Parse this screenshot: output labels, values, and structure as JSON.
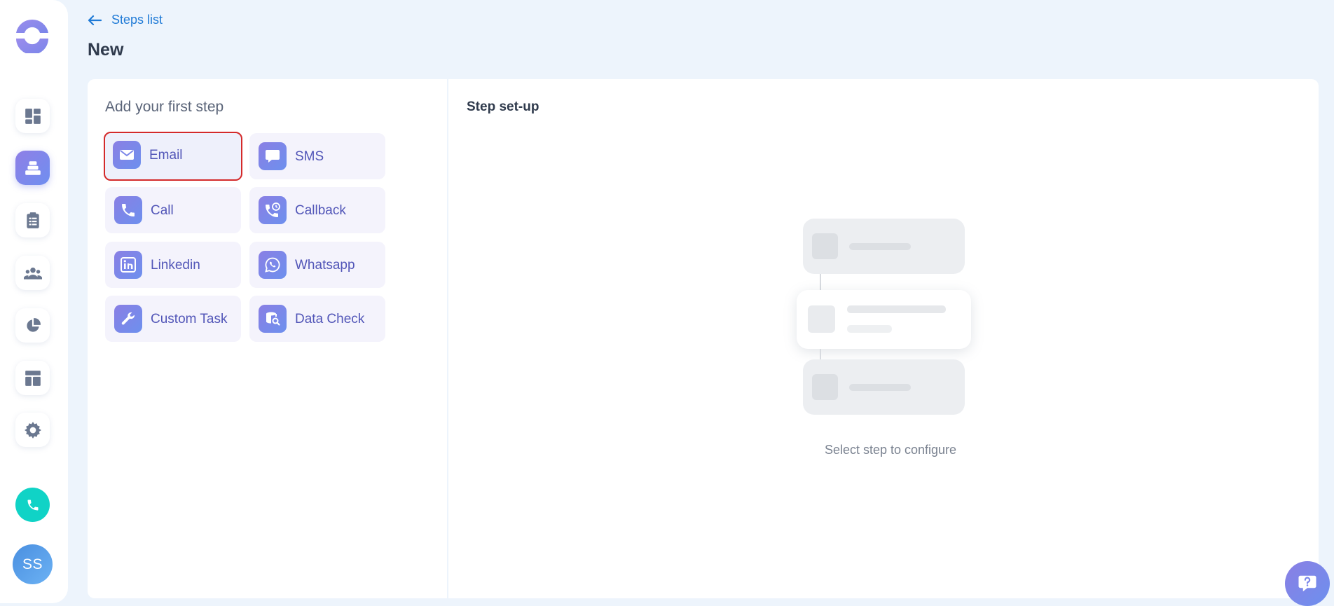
{
  "header": {
    "back_label": "Steps list",
    "title": "New"
  },
  "sidebar": {
    "items": [
      {
        "icon": "dashboard-icon",
        "active": false
      },
      {
        "icon": "sequences-icon",
        "active": true
      },
      {
        "icon": "tasks-icon",
        "active": false
      },
      {
        "icon": "contacts-icon",
        "active": false
      },
      {
        "icon": "reports-icon",
        "active": false
      },
      {
        "icon": "templates-icon",
        "active": false
      },
      {
        "icon": "settings-icon",
        "active": false
      }
    ],
    "avatar_initials": "SS"
  },
  "steps_panel": {
    "heading": "Add your first step",
    "steps": [
      {
        "label": "Email",
        "icon": "email-icon",
        "selected": true
      },
      {
        "label": "SMS",
        "icon": "sms-icon",
        "selected": false
      },
      {
        "label": "Call",
        "icon": "call-icon",
        "selected": false
      },
      {
        "label": "Callback",
        "icon": "callback-icon",
        "selected": false
      },
      {
        "label": "Linkedin",
        "icon": "linkedin-icon",
        "selected": false
      },
      {
        "label": "Whatsapp",
        "icon": "whatsapp-icon",
        "selected": false
      },
      {
        "label": "Custom Task",
        "icon": "wrench-icon",
        "selected": false
      },
      {
        "label": "Data Check",
        "icon": "data-check-icon",
        "selected": false
      }
    ]
  },
  "setup_panel": {
    "heading": "Step set-up",
    "empty_text": "Select step to configure"
  },
  "colors": {
    "accent": "#6d90ee",
    "link": "#1f7ad6",
    "selected_border": "#d42a2a",
    "phone": "#10d3c6"
  }
}
